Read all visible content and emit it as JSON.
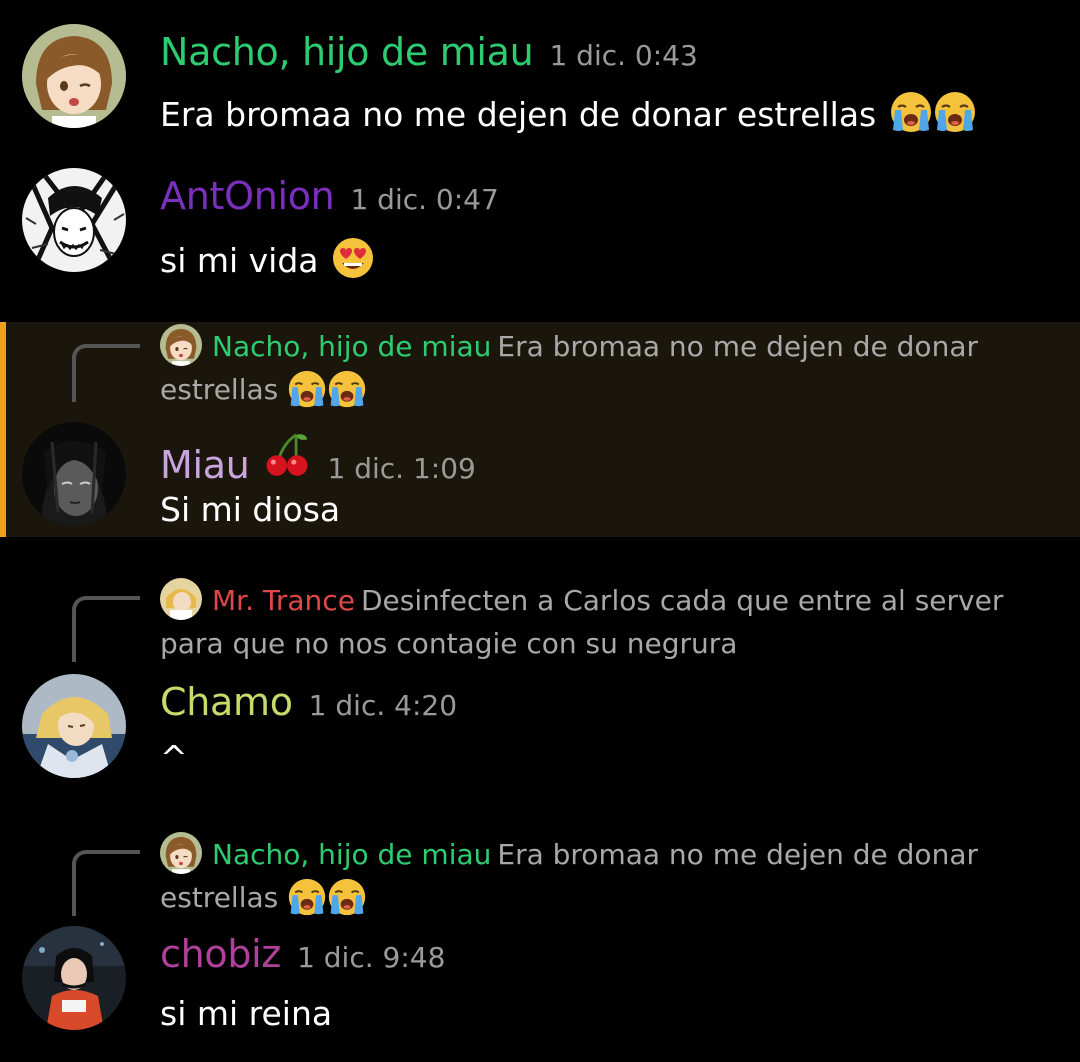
{
  "colors": {
    "background": "#000000",
    "highlight_background": "#1b160b",
    "highlight_bar": "#f0a020",
    "timestamp": "#9a9a9a",
    "reply_text": "#a8a8a8"
  },
  "messages": [
    {
      "author": "Nacho, hijo de miau",
      "author_color": "#2ecc71",
      "timestamp": "1 dic. 0:43",
      "text": "Era bromaa no me dejen de donar estrellas",
      "emojis": [
        "loudly-crying-face",
        "loudly-crying-face"
      ],
      "avatar": "anime-girl-brown-hair-avatar"
    },
    {
      "author": "AntOnion",
      "author_color": "#7b2fbe",
      "timestamp": "1 dic. 0:47",
      "text": "si mi vida",
      "emojis": [
        "heart-eyes-face"
      ],
      "avatar": "manga-sketch-avatar"
    },
    {
      "author": "Miau",
      "author_badge": "cherries",
      "author_color": "#c9a5e0",
      "timestamp": "1 dic. 1:09",
      "text": "Si mi diosa",
      "highlighted": true,
      "avatar": "dark-haired-anime-avatar",
      "reply": {
        "author": "Nacho, hijo de miau",
        "author_color": "#2ecc71",
        "text": "Era bromaa no me dejen de donar estrellas",
        "emojis": [
          "loudly-crying-face",
          "loudly-crying-face"
        ]
      }
    },
    {
      "author": "Chamo",
      "author_color": "#c6dc6a",
      "timestamp": "1 dic. 4:20",
      "text": "^",
      "avatar": "blonde-anime-avatar",
      "reply": {
        "author": "Mr. Trance",
        "author_color": "#e04848",
        "text": "Desinfecten a Carlos cada que entre al server para que no nos contagie con su negrura"
      }
    },
    {
      "author": "chobiz",
      "author_color": "#b0409a",
      "timestamp": "1 dic. 9:48",
      "text": "si mi reina",
      "avatar": "dark-photo-girl-avatar",
      "reply": {
        "author": "Nacho, hijo de miau",
        "author_color": "#2ecc71",
        "text": "Era bromaa no me dejen de donar estrellas",
        "emojis": [
          "loudly-crying-face",
          "loudly-crying-face"
        ]
      }
    }
  ]
}
